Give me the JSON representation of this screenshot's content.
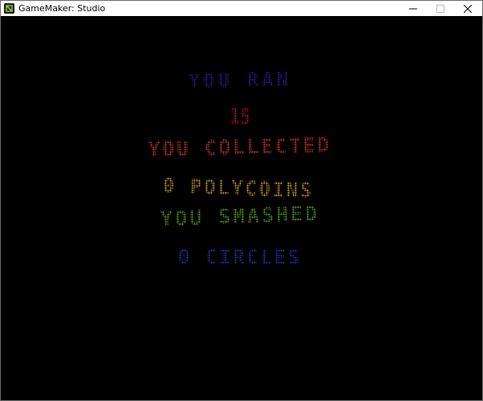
{
  "window": {
    "title": "GameMaker: Studio",
    "controls": {
      "minimize_icon": "minimize-icon",
      "maximize_icon": "maximize-icon",
      "close_icon": "close-icon"
    }
  },
  "game": {
    "background_color": "#000000",
    "lines": [
      {
        "id": "line-you-ran",
        "text": "YOU RAN",
        "color": "#2d1fa6"
      },
      {
        "id": "line-ran-count",
        "text": "15",
        "color": "#c2143a"
      },
      {
        "id": "line-you-collected",
        "text": "YOU COLLECTED",
        "color": "#d63a22"
      },
      {
        "id": "line-polycoins",
        "text": "0 POLYCOINS",
        "color": "#d9a316"
      },
      {
        "id": "line-you-smashed",
        "text": "YOU SMASHED",
        "color": "#58a81e"
      },
      {
        "id": "line-circles",
        "text": "0 CIRCLES",
        "color": "#1f35b8"
      }
    ]
  }
}
